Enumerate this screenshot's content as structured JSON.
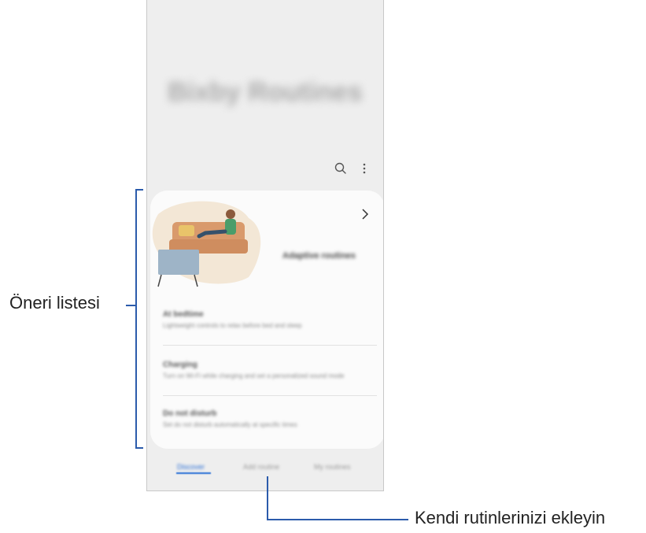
{
  "app": {
    "title": "Bixby Routines"
  },
  "toolbar": {
    "search_icon": "search-icon",
    "more_icon": "more-options-icon"
  },
  "suggestion_card": {
    "title": "Adaptive routines",
    "items": [
      {
        "title": "At bedtime",
        "subtitle": "Lightweight controls to relax before bed and sleep"
      },
      {
        "title": "Charging",
        "subtitle": "Turn on Wi-Fi while charging and set a personalized sound mode"
      },
      {
        "title": "Do not disturb",
        "subtitle": "Set do not disturb automatically at specific times"
      }
    ]
  },
  "tabs": [
    {
      "label": "Discover",
      "active": true
    },
    {
      "label": "Add routine",
      "active": false
    },
    {
      "label": "My routines",
      "active": false
    }
  ],
  "annotations": {
    "left_label": "Öneri listesi",
    "bottom_label": "Kendi rutinlerinizi ekleyin"
  },
  "colors": {
    "accent": "#2a6fd6",
    "annotation_line": "#2b5bab"
  }
}
